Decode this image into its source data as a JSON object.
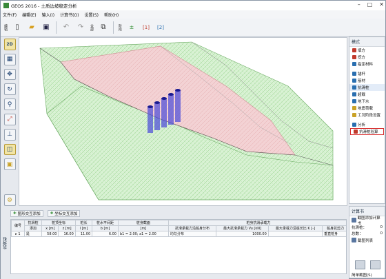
{
  "window": {
    "title": "GEOS 2016 - 土质边坡稳定分析",
    "controls": [
      "–",
      "□",
      "✕"
    ]
  },
  "menu": [
    "文件(F)",
    "编辑(E)",
    "输入(I)",
    "计算书(O)",
    "设置(S)",
    "帮助(H)"
  ],
  "toolbar": {
    "edit_label": "编辑",
    "cut_label": "全部",
    "nav_label": "阶段",
    "stage_label": "[1]",
    "stage2_label": "[2]"
  },
  "left_tools": [
    {
      "icon": "2d-icon",
      "label": "2D"
    },
    {
      "icon": "3d-box-icon",
      "label": ""
    },
    {
      "icon": "move-icon",
      "label": "✥"
    },
    {
      "icon": "rotate-icon",
      "label": "↻"
    },
    {
      "icon": "zoom-icon",
      "label": "⚲"
    },
    {
      "icon": "fit-icon",
      "label": "⤢"
    },
    {
      "icon": "axis-icon",
      "label": "⊥"
    },
    {
      "icon": "view-front-icon",
      "label": "◫"
    },
    {
      "icon": "view-iso-icon",
      "label": "▣"
    },
    {
      "icon": "settings-icon",
      "label": "⚙"
    }
  ],
  "right_panel": {
    "header": "模式",
    "items": [
      {
        "label": "填方",
        "color": "#c0392b"
      },
      {
        "label": "挖方",
        "color": "#c0392b"
      },
      {
        "label": "指定材料",
        "color": "#2a6fb0"
      },
      {
        "gap": true
      },
      {
        "label": "锚杆",
        "color": "#2a6fb0"
      },
      {
        "label": "筋材",
        "color": "#2a6fb0"
      },
      {
        "label": "抗滑桩",
        "color": "#2a6fb0",
        "selected_bg": true
      },
      {
        "label": "超载",
        "color": "#2a6fb0"
      },
      {
        "label": "地下水",
        "color": "#2a6fb0"
      },
      {
        "label": "地震荷载",
        "color": "#c9a227"
      },
      {
        "label": "工况阶段设置",
        "color": "#c9a227"
      },
      {
        "gap": true
      },
      {
        "label": "分析",
        "color": "#2a6fb0"
      },
      {
        "label": "抗滑桩验算",
        "color": "#c0392b",
        "selected": true
      }
    ]
  },
  "bottom": {
    "side_tab": "抗滑桩",
    "add_graphic_btn": "图形交互添加",
    "add_coord_btn": "坐标交互添加",
    "headers_top": [
      "编号",
      "抗滑桩",
      "桩顶坐标",
      "",
      "桩长",
      "桩水平间距",
      "桩身截面",
      "",
      "桩身抗滑承载力",
      "",
      "",
      ""
    ],
    "headers_sub": [
      "",
      "添加",
      "x [m]",
      "z [m]",
      "l [m]",
      "b [m]",
      "[m]",
      "",
      "抗滑承载力沿桩身分布",
      "最大抗滑承载力 Vu [kN]",
      "最大承载力沿桩长比 K [-]",
      "桩身抗剪力"
    ],
    "row": {
      "mark": "▸",
      "no": "1",
      "add": "是",
      "x": "58.00",
      "z": "16.00",
      "l": "11.00",
      "b": "6.00",
      "section": "b1 = 2.00; a1 = 2.00",
      "dist": "均匀分布",
      "vu": "1000.00",
      "k": "",
      "shear": "垂直桩身"
    }
  },
  "calc_panel": {
    "header": "计算书",
    "add_btn": "截图添加计算书",
    "rows": [
      {
        "label": "抗滑桩：",
        "value": "0"
      },
      {
        "label": "总数：",
        "value": "0"
      }
    ],
    "list_btn": "截图列表",
    "print_btn": "简单截图(S)"
  }
}
